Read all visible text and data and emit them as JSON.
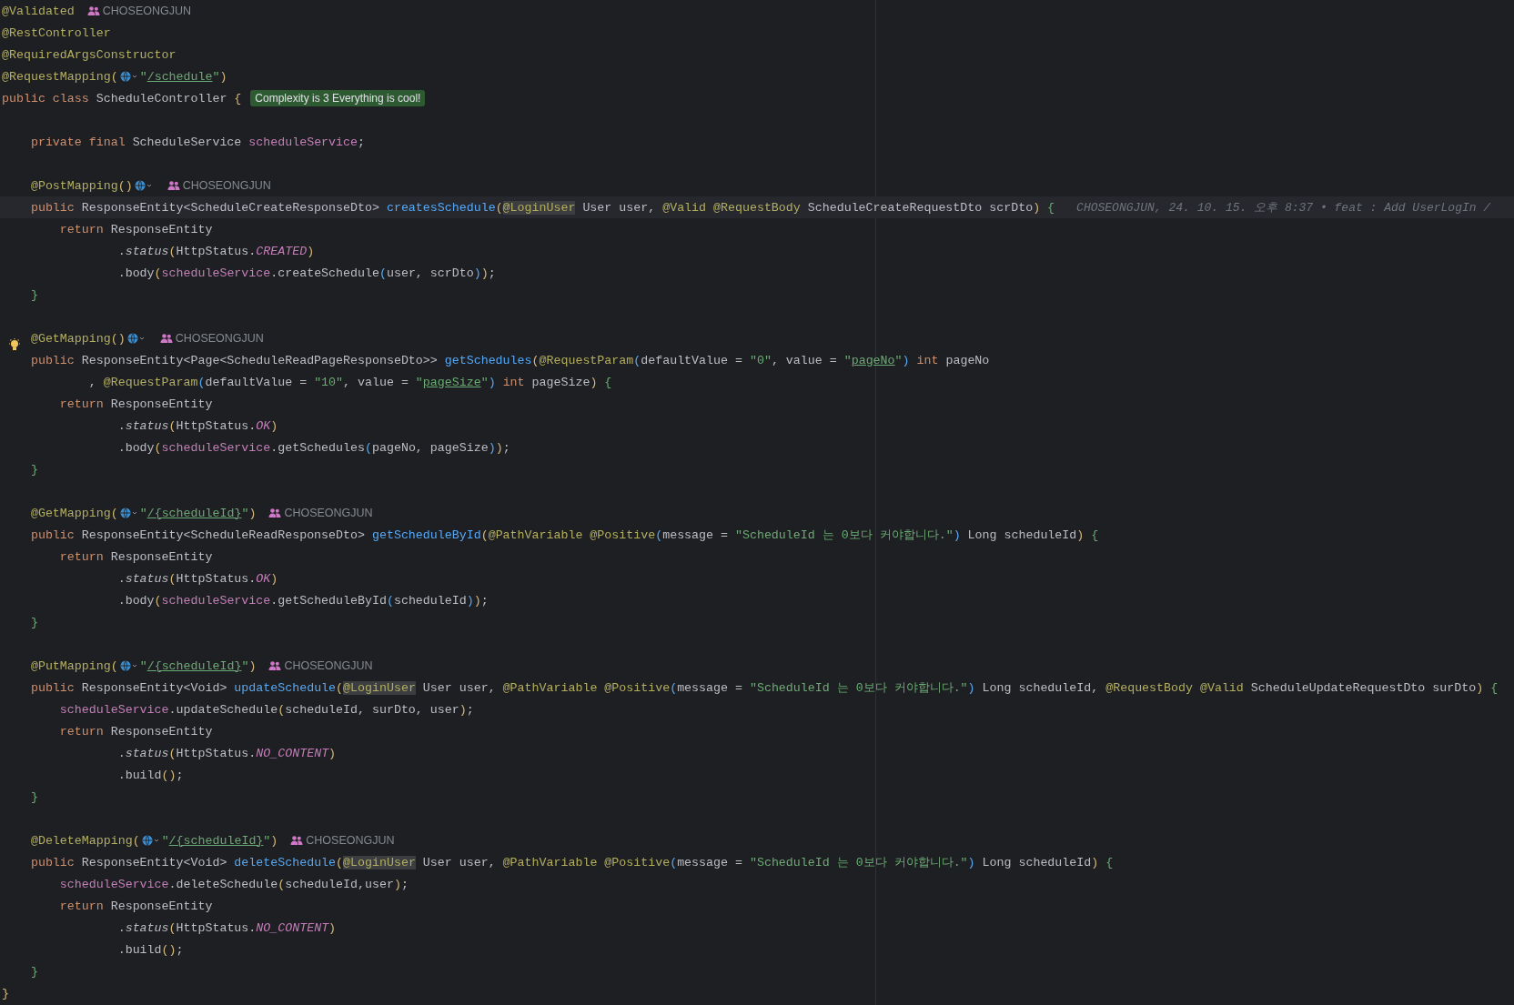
{
  "editor": {
    "lines": [
      {
        "current": false,
        "bulb": false,
        "segments": [
          {
            "kind": "code",
            "tokens": [
              {
                "kind": "ann",
                "text": "@Validated"
              }
            ]
          },
          {
            "kind": "author",
            "text": "CHOSEONGJUN"
          }
        ]
      },
      {
        "current": false,
        "bulb": false,
        "segments": [
          {
            "kind": "code",
            "tokens": [
              {
                "kind": "ann",
                "text": "@RestController"
              }
            ]
          }
        ]
      },
      {
        "current": false,
        "bulb": false,
        "segments": [
          {
            "kind": "code",
            "tokens": [
              {
                "kind": "ann",
                "text": "@RequiredArgsConstructor"
              }
            ]
          }
        ]
      },
      {
        "current": false,
        "bulb": false,
        "segments": [
          {
            "kind": "code",
            "tokens": [
              {
                "kind": "ann",
                "text": "@RequestMapping"
              },
              {
                "kind": "br1",
                "text": "("
              }
            ]
          },
          {
            "kind": "endpoint"
          },
          {
            "kind": "code",
            "tokens": [
              {
                "kind": "str",
                "text": "\""
              },
              {
                "kind": "link",
                "text": "/schedule"
              },
              {
                "kind": "str",
                "text": "\""
              },
              {
                "kind": "br1",
                "text": ")"
              }
            ]
          }
        ]
      },
      {
        "current": false,
        "bulb": false,
        "segments": [
          {
            "kind": "code",
            "tokens": [
              {
                "kind": "kw",
                "text": "public class "
              },
              {
                "kind": "plain",
                "text": "ScheduleController "
              },
              {
                "kind": "br1",
                "text": "{"
              }
            ]
          },
          {
            "kind": "badge",
            "text": "Complexity is 3 Everything is cool!"
          }
        ]
      },
      {
        "current": false,
        "bulb": false
      },
      {
        "current": false,
        "bulb": false,
        "segments": [
          {
            "kind": "code",
            "tokens": [
              {
                "kind": "kw",
                "text": "    private final "
              },
              {
                "kind": "plain",
                "text": "ScheduleService "
              },
              {
                "kind": "field",
                "text": "scheduleService"
              },
              {
                "kind": "plain",
                "text": ";"
              }
            ]
          }
        ]
      },
      {
        "current": false,
        "bulb": false
      },
      {
        "current": false,
        "bulb": false,
        "segments": [
          {
            "kind": "code",
            "tokens": [
              {
                "kind": "ann",
                "text": "    @PostMapping"
              },
              {
                "kind": "br1",
                "text": "()"
              }
            ]
          },
          {
            "kind": "endpoint"
          },
          {
            "kind": "author",
            "text": "CHOSEONGJUN"
          }
        ]
      },
      {
        "current": true,
        "bulb": false,
        "segments": [
          {
            "kind": "code",
            "tokens": [
              {
                "kind": "kw",
                "text": "    public "
              },
              {
                "kind": "plain",
                "text": "ResponseEntity<ScheduleCreateResponseDto> "
              },
              {
                "kind": "method",
                "text": "createsSchedule"
              },
              {
                "kind": "br1",
                "text": "("
              },
              {
                "kind": "hl",
                "text": "@LoginUser"
              },
              {
                "kind": "plain",
                "text": " User user, "
              },
              {
                "kind": "ann",
                "text": "@Valid @RequestBody "
              },
              {
                "kind": "plain",
                "text": "ScheduleCreateRequestDto scrDto"
              },
              {
                "kind": "br1",
                "text": ")"
              },
              {
                "kind": "br2",
                "text": " {"
              }
            ]
          },
          {
            "kind": "blame",
            "text": "CHOSEONGJUN, 24. 10. 15. 오후 8:37 • feat : Add UserLogIn /"
          }
        ]
      },
      {
        "current": false,
        "bulb": false,
        "segments": [
          {
            "kind": "code",
            "tokens": [
              {
                "kind": "kw",
                "text": "        return "
              },
              {
                "kind": "plain",
                "text": "ResponseEntity"
              }
            ]
          }
        ]
      },
      {
        "current": false,
        "bulb": false,
        "segments": [
          {
            "kind": "code",
            "tokens": [
              {
                "kind": "plain",
                "text": "                ."
              },
              {
                "kind": "call",
                "text": "status"
              },
              {
                "kind": "br1",
                "text": "("
              },
              {
                "kind": "plain",
                "text": "HttpStatus."
              },
              {
                "kind": "const",
                "text": "CREATED"
              },
              {
                "kind": "br1",
                "text": ")"
              }
            ]
          }
        ]
      },
      {
        "current": false,
        "bulb": false,
        "segments": [
          {
            "kind": "code",
            "tokens": [
              {
                "kind": "plain",
                "text": "                .body"
              },
              {
                "kind": "br1",
                "text": "("
              },
              {
                "kind": "field",
                "text": "scheduleService"
              },
              {
                "kind": "plain",
                "text": ".createSchedule"
              },
              {
                "kind": "br3",
                "text": "("
              },
              {
                "kind": "plain",
                "text": "user, scrDto"
              },
              {
                "kind": "br3",
                "text": ")"
              },
              {
                "kind": "br1",
                "text": ")"
              },
              {
                "kind": "plain",
                "text": ";"
              }
            ]
          }
        ]
      },
      {
        "current": false,
        "bulb": false,
        "segments": [
          {
            "kind": "code",
            "tokens": [
              {
                "kind": "br2",
                "text": "    }"
              }
            ]
          }
        ]
      },
      {
        "current": false,
        "bulb": false
      },
      {
        "current": false,
        "bulb": true,
        "segments": [
          {
            "kind": "code",
            "tokens": [
              {
                "kind": "ann",
                "text": "    @GetMapping"
              },
              {
                "kind": "br1",
                "text": "()"
              }
            ]
          },
          {
            "kind": "endpoint"
          },
          {
            "kind": "author",
            "text": "CHOSEONGJUN"
          }
        ]
      },
      {
        "current": false,
        "bulb": false,
        "segments": [
          {
            "kind": "code",
            "tokens": [
              {
                "kind": "kw",
                "text": "    public "
              },
              {
                "kind": "plain",
                "text": "ResponseEntity<Page<ScheduleReadPageResponseDto>> "
              },
              {
                "kind": "method",
                "text": "getSchedules"
              },
              {
                "kind": "br1",
                "text": "("
              },
              {
                "kind": "ann",
                "text": "@RequestParam"
              },
              {
                "kind": "br3",
                "text": "("
              },
              {
                "kind": "plain",
                "text": "defaultValue = "
              },
              {
                "kind": "str",
                "text": "\"0\""
              },
              {
                "kind": "plain",
                "text": ", value = "
              },
              {
                "kind": "str",
                "text": "\""
              },
              {
                "kind": "link",
                "text": "pageNo"
              },
              {
                "kind": "str",
                "text": "\""
              },
              {
                "kind": "br3",
                "text": ")"
              },
              {
                "kind": "kw",
                "text": " int "
              },
              {
                "kind": "plain",
                "text": "pageNo"
              }
            ]
          }
        ]
      },
      {
        "current": false,
        "bulb": false,
        "segments": [
          {
            "kind": "code",
            "tokens": [
              {
                "kind": "plain",
                "text": "            , "
              },
              {
                "kind": "ann",
                "text": "@RequestParam"
              },
              {
                "kind": "br3",
                "text": "("
              },
              {
                "kind": "plain",
                "text": "defaultValue = "
              },
              {
                "kind": "str",
                "text": "\"10\""
              },
              {
                "kind": "plain",
                "text": ", value = "
              },
              {
                "kind": "str",
                "text": "\""
              },
              {
                "kind": "link",
                "text": "pageSize"
              },
              {
                "kind": "str",
                "text": "\""
              },
              {
                "kind": "br3",
                "text": ")"
              },
              {
                "kind": "kw",
                "text": " int "
              },
              {
                "kind": "plain",
                "text": "pageSize"
              },
              {
                "kind": "br1",
                "text": ")"
              },
              {
                "kind": "br2",
                "text": " {"
              }
            ]
          }
        ]
      },
      {
        "current": false,
        "bulb": false,
        "segments": [
          {
            "kind": "code",
            "tokens": [
              {
                "kind": "kw",
                "text": "        return "
              },
              {
                "kind": "plain",
                "text": "ResponseEntity"
              }
            ]
          }
        ]
      },
      {
        "current": false,
        "bulb": false,
        "segments": [
          {
            "kind": "code",
            "tokens": [
              {
                "kind": "plain",
                "text": "                ."
              },
              {
                "kind": "call",
                "text": "status"
              },
              {
                "kind": "br1",
                "text": "("
              },
              {
                "kind": "plain",
                "text": "HttpStatus."
              },
              {
                "kind": "const",
                "text": "OK"
              },
              {
                "kind": "br1",
                "text": ")"
              }
            ]
          }
        ]
      },
      {
        "current": false,
        "bulb": false,
        "segments": [
          {
            "kind": "code",
            "tokens": [
              {
                "kind": "plain",
                "text": "                .body"
              },
              {
                "kind": "br1",
                "text": "("
              },
              {
                "kind": "field",
                "text": "scheduleService"
              },
              {
                "kind": "plain",
                "text": ".getSchedules"
              },
              {
                "kind": "br3",
                "text": "("
              },
              {
                "kind": "plain",
                "text": "pageNo, pageSize"
              },
              {
                "kind": "br3",
                "text": ")"
              },
              {
                "kind": "br1",
                "text": ")"
              },
              {
                "kind": "plain",
                "text": ";"
              }
            ]
          }
        ]
      },
      {
        "current": false,
        "bulb": false,
        "segments": [
          {
            "kind": "code",
            "tokens": [
              {
                "kind": "br2",
                "text": "    }"
              }
            ]
          }
        ]
      },
      {
        "current": false,
        "bulb": false
      },
      {
        "current": false,
        "bulb": false,
        "segments": [
          {
            "kind": "code",
            "tokens": [
              {
                "kind": "ann",
                "text": "    @GetMapping"
              },
              {
                "kind": "br1",
                "text": "("
              }
            ]
          },
          {
            "kind": "endpoint"
          },
          {
            "kind": "code",
            "tokens": [
              {
                "kind": "str",
                "text": "\""
              },
              {
                "kind": "link",
                "text": "/{scheduleId}"
              },
              {
                "kind": "str",
                "text": "\""
              },
              {
                "kind": "br1",
                "text": ")"
              }
            ]
          },
          {
            "kind": "author",
            "text": "CHOSEONGJUN"
          }
        ]
      },
      {
        "current": false,
        "bulb": false,
        "segments": [
          {
            "kind": "code",
            "tokens": [
              {
                "kind": "kw",
                "text": "    public "
              },
              {
                "kind": "plain",
                "text": "ResponseEntity<ScheduleReadResponseDto> "
              },
              {
                "kind": "method",
                "text": "getScheduleById"
              },
              {
                "kind": "br1",
                "text": "("
              },
              {
                "kind": "ann",
                "text": "@PathVariable @Positive"
              },
              {
                "kind": "br3",
                "text": "("
              },
              {
                "kind": "plain",
                "text": "message = "
              },
              {
                "kind": "str",
                "text": "\"ScheduleId 는 0보다 커야합니다.\""
              },
              {
                "kind": "br3",
                "text": ")"
              },
              {
                "kind": "plain",
                "text": " Long scheduleId"
              },
              {
                "kind": "br1",
                "text": ")"
              },
              {
                "kind": "br2",
                "text": " {"
              }
            ]
          }
        ]
      },
      {
        "current": false,
        "bulb": false,
        "segments": [
          {
            "kind": "code",
            "tokens": [
              {
                "kind": "kw",
                "text": "        return "
              },
              {
                "kind": "plain",
                "text": "ResponseEntity"
              }
            ]
          }
        ]
      },
      {
        "current": false,
        "bulb": false,
        "segments": [
          {
            "kind": "code",
            "tokens": [
              {
                "kind": "plain",
                "text": "                ."
              },
              {
                "kind": "call",
                "text": "status"
              },
              {
                "kind": "br1",
                "text": "("
              },
              {
                "kind": "plain",
                "text": "HttpStatus."
              },
              {
                "kind": "const",
                "text": "OK"
              },
              {
                "kind": "br1",
                "text": ")"
              }
            ]
          }
        ]
      },
      {
        "current": false,
        "bulb": false,
        "segments": [
          {
            "kind": "code",
            "tokens": [
              {
                "kind": "plain",
                "text": "                .body"
              },
              {
                "kind": "br1",
                "text": "("
              },
              {
                "kind": "field",
                "text": "scheduleService"
              },
              {
                "kind": "plain",
                "text": ".getScheduleById"
              },
              {
                "kind": "br3",
                "text": "("
              },
              {
                "kind": "plain",
                "text": "scheduleId"
              },
              {
                "kind": "br3",
                "text": ")"
              },
              {
                "kind": "br1",
                "text": ")"
              },
              {
                "kind": "plain",
                "text": ";"
              }
            ]
          }
        ]
      },
      {
        "current": false,
        "bulb": false,
        "segments": [
          {
            "kind": "code",
            "tokens": [
              {
                "kind": "br2",
                "text": "    }"
              }
            ]
          }
        ]
      },
      {
        "current": false,
        "bulb": false
      },
      {
        "current": false,
        "bulb": false,
        "segments": [
          {
            "kind": "code",
            "tokens": [
              {
                "kind": "ann",
                "text": "    @PutMapping"
              },
              {
                "kind": "br1",
                "text": "("
              }
            ]
          },
          {
            "kind": "endpoint"
          },
          {
            "kind": "code",
            "tokens": [
              {
                "kind": "str",
                "text": "\""
              },
              {
                "kind": "link",
                "text": "/{scheduleId}"
              },
              {
                "kind": "str",
                "text": "\""
              },
              {
                "kind": "br1",
                "text": ")"
              }
            ]
          },
          {
            "kind": "author",
            "text": "CHOSEONGJUN"
          }
        ]
      },
      {
        "current": false,
        "bulb": false,
        "segments": [
          {
            "kind": "code",
            "tokens": [
              {
                "kind": "kw",
                "text": "    public "
              },
              {
                "kind": "plain",
                "text": "ResponseEntity<Void> "
              },
              {
                "kind": "method",
                "text": "updateSchedule"
              },
              {
                "kind": "br1",
                "text": "("
              },
              {
                "kind": "hl",
                "text": "@LoginUser"
              },
              {
                "kind": "plain",
                "text": " User user, "
              },
              {
                "kind": "ann",
                "text": "@PathVariable @Positive"
              },
              {
                "kind": "br3",
                "text": "("
              },
              {
                "kind": "plain",
                "text": "message = "
              },
              {
                "kind": "str",
                "text": "\"ScheduleId 는 0보다 커야합니다.\""
              },
              {
                "kind": "br3",
                "text": ")"
              },
              {
                "kind": "plain",
                "text": " Long scheduleId, "
              },
              {
                "kind": "ann",
                "text": "@RequestBody @Valid "
              },
              {
                "kind": "plain",
                "text": "ScheduleUpdateRequestDto surDto"
              },
              {
                "kind": "br1",
                "text": ")"
              },
              {
                "kind": "br2",
                "text": " {"
              }
            ]
          }
        ]
      },
      {
        "current": false,
        "bulb": false,
        "segments": [
          {
            "kind": "code",
            "tokens": [
              {
                "kind": "field",
                "text": "        scheduleService"
              },
              {
                "kind": "plain",
                "text": ".updateSchedule"
              },
              {
                "kind": "br1",
                "text": "("
              },
              {
                "kind": "plain",
                "text": "scheduleId, surDto, user"
              },
              {
                "kind": "br1",
                "text": ")"
              },
              {
                "kind": "plain",
                "text": ";"
              }
            ]
          }
        ]
      },
      {
        "current": false,
        "bulb": false,
        "segments": [
          {
            "kind": "code",
            "tokens": [
              {
                "kind": "kw",
                "text": "        return "
              },
              {
                "kind": "plain",
                "text": "ResponseEntity"
              }
            ]
          }
        ]
      },
      {
        "current": false,
        "bulb": false,
        "segments": [
          {
            "kind": "code",
            "tokens": [
              {
                "kind": "plain",
                "text": "                ."
              },
              {
                "kind": "call",
                "text": "status"
              },
              {
                "kind": "br1",
                "text": "("
              },
              {
                "kind": "plain",
                "text": "HttpStatus."
              },
              {
                "kind": "const",
                "text": "NO_CONTENT"
              },
              {
                "kind": "br1",
                "text": ")"
              }
            ]
          }
        ]
      },
      {
        "current": false,
        "bulb": false,
        "segments": [
          {
            "kind": "code",
            "tokens": [
              {
                "kind": "plain",
                "text": "                .build"
              },
              {
                "kind": "br1",
                "text": "()"
              },
              {
                "kind": "plain",
                "text": ";"
              }
            ]
          }
        ]
      },
      {
        "current": false,
        "bulb": false,
        "segments": [
          {
            "kind": "code",
            "tokens": [
              {
                "kind": "br2",
                "text": "    }"
              }
            ]
          }
        ]
      },
      {
        "current": false,
        "bulb": false
      },
      {
        "current": false,
        "bulb": false,
        "segments": [
          {
            "kind": "code",
            "tokens": [
              {
                "kind": "ann",
                "text": "    @DeleteMapping"
              },
              {
                "kind": "br1",
                "text": "("
              }
            ]
          },
          {
            "kind": "endpoint"
          },
          {
            "kind": "code",
            "tokens": [
              {
                "kind": "str",
                "text": "\""
              },
              {
                "kind": "link",
                "text": "/{scheduleId}"
              },
              {
                "kind": "str",
                "text": "\""
              },
              {
                "kind": "br1",
                "text": ")"
              }
            ]
          },
          {
            "kind": "author",
            "text": "CHOSEONGJUN"
          }
        ]
      },
      {
        "current": false,
        "bulb": false,
        "segments": [
          {
            "kind": "code",
            "tokens": [
              {
                "kind": "kw",
                "text": "    public "
              },
              {
                "kind": "plain",
                "text": "ResponseEntity<Void> "
              },
              {
                "kind": "method",
                "text": "deleteSchedule"
              },
              {
                "kind": "br1",
                "text": "("
              },
              {
                "kind": "hl",
                "text": "@LoginUser"
              },
              {
                "kind": "plain",
                "text": " User user, "
              },
              {
                "kind": "ann",
                "text": "@PathVariable @Positive"
              },
              {
                "kind": "br3",
                "text": "("
              },
              {
                "kind": "plain",
                "text": "message = "
              },
              {
                "kind": "str",
                "text": "\"ScheduleId 는 0보다 커야합니다.\""
              },
              {
                "kind": "br3",
                "text": ")"
              },
              {
                "kind": "plain",
                "text": " Long scheduleId"
              },
              {
                "kind": "br1",
                "text": ")"
              },
              {
                "kind": "br2",
                "text": " {"
              }
            ]
          }
        ]
      },
      {
        "current": false,
        "bulb": false,
        "segments": [
          {
            "kind": "code",
            "tokens": [
              {
                "kind": "field",
                "text": "        scheduleService"
              },
              {
                "kind": "plain",
                "text": ".deleteSchedule"
              },
              {
                "kind": "br1",
                "text": "("
              },
              {
                "kind": "plain",
                "text": "scheduleId,user"
              },
              {
                "kind": "br1",
                "text": ")"
              },
              {
                "kind": "plain",
                "text": ";"
              }
            ]
          }
        ]
      },
      {
        "current": false,
        "bulb": false,
        "segments": [
          {
            "kind": "code",
            "tokens": [
              {
                "kind": "kw",
                "text": "        return "
              },
              {
                "kind": "plain",
                "text": "ResponseEntity"
              }
            ]
          }
        ]
      },
      {
        "current": false,
        "bulb": false,
        "segments": [
          {
            "kind": "code",
            "tokens": [
              {
                "kind": "plain",
                "text": "                ."
              },
              {
                "kind": "call",
                "text": "status"
              },
              {
                "kind": "br1",
                "text": "("
              },
              {
                "kind": "plain",
                "text": "HttpStatus."
              },
              {
                "kind": "const",
                "text": "NO_CONTENT"
              },
              {
                "kind": "br1",
                "text": ")"
              }
            ]
          }
        ]
      },
      {
        "current": false,
        "bulb": false,
        "segments": [
          {
            "kind": "code",
            "tokens": [
              {
                "kind": "plain",
                "text": "                .build"
              },
              {
                "kind": "br1",
                "text": "()"
              },
              {
                "kind": "plain",
                "text": ";"
              }
            ]
          }
        ]
      },
      {
        "current": false,
        "bulb": false,
        "segments": [
          {
            "kind": "code",
            "tokens": [
              {
                "kind": "br2",
                "text": "    }"
              }
            ]
          }
        ]
      },
      {
        "current": false,
        "bulb": false,
        "segments": [
          {
            "kind": "code",
            "tokens": [
              {
                "kind": "br1",
                "text": "}"
              }
            ]
          }
        ]
      }
    ]
  }
}
